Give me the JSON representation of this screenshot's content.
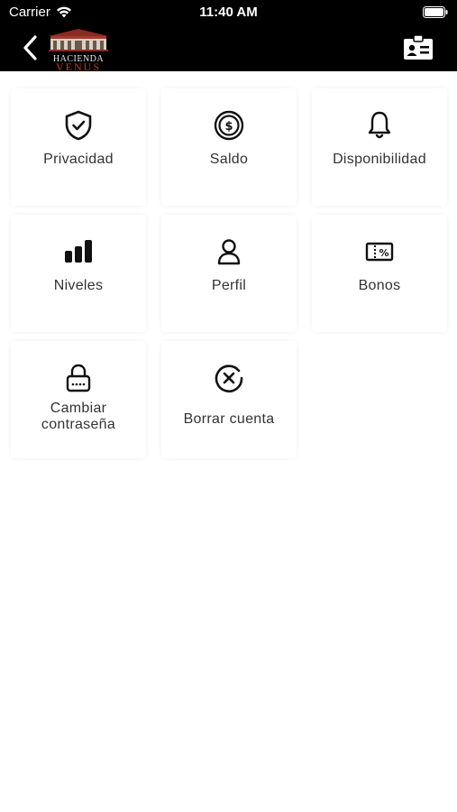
{
  "status_bar": {
    "carrier": "Carrier",
    "time": "11:40 AM"
  },
  "header": {
    "logo_line1": "HACIENDA",
    "logo_line2": "VENUS",
    "back_icon": "chevron-left-icon",
    "id_card_icon": "id-card-icon"
  },
  "menu": {
    "items": [
      {
        "label": "Privacidad",
        "icon": "shield-check-icon"
      },
      {
        "label": "Saldo",
        "icon": "coin-dollar-icon"
      },
      {
        "label": "Disponibilidad",
        "icon": "bell-icon"
      },
      {
        "label": "Niveles",
        "icon": "signal-bars-icon"
      },
      {
        "label": "Perfil",
        "icon": "user-icon"
      },
      {
        "label": "Bonos",
        "icon": "percent-ticket-icon"
      },
      {
        "label": "Cambiar contraseña",
        "icon": "lock-icon"
      },
      {
        "label": "Borrar cuenta",
        "icon": "delete-circle-icon"
      }
    ]
  },
  "colors": {
    "header_bg": "#000000",
    "page_bg": "#ffffff",
    "logo_red": "#c0392b"
  }
}
